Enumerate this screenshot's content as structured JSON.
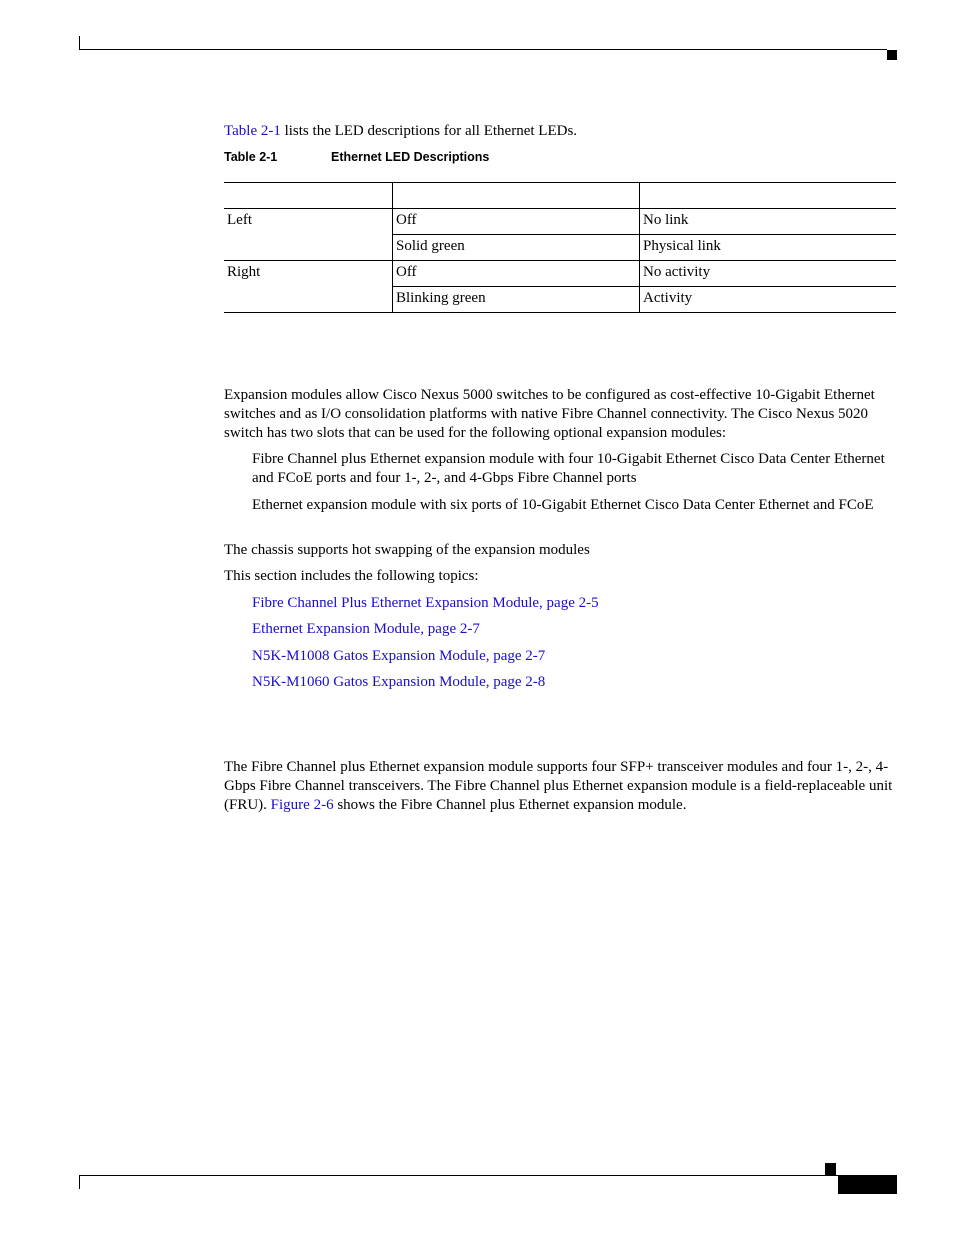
{
  "intro": {
    "link": "Table 2-1",
    "text": " lists the LED descriptions for all Ethernet LEDs."
  },
  "table_caption": {
    "number": "Table 2-1",
    "title": "Ethernet LED Descriptions"
  },
  "led_table": {
    "headers": [
      "",
      "",
      ""
    ],
    "rows": [
      {
        "led": "Left",
        "status": "Off",
        "description": "No link"
      },
      {
        "led": "",
        "status": "Solid green",
        "description": "Physical link"
      },
      {
        "led": "Right",
        "status": "Off",
        "description": "No activity"
      },
      {
        "led": "",
        "status": "Blinking green",
        "description": "Activity"
      }
    ]
  },
  "expansion": {
    "paragraph": "Expansion modules allow Cisco Nexus 5000 switches to be configured as cost-effective 10-Gigabit Ethernet switches and as I/O consolidation platforms with native Fibre Channel connectivity. The Cisco Nexus 5020 switch has two slots that can be used for the following optional expansion modules:",
    "bullets": [
      "Fibre Channel plus Ethernet expansion module with four 10-Gigabit Ethernet Cisco Data Center Ethernet and FCoE ports and four 1-, 2-, and 4-Gbps Fibre Channel ports",
      "Ethernet expansion module with six ports of 10-Gigabit Ethernet Cisco Data Center Ethernet and FCoE"
    ],
    "hot_swap": "The chassis supports hot swapping of the expansion modules",
    "topics_intro": "This section includes the following topics:",
    "topics": [
      "Fibre Channel Plus Ethernet Expansion Module, page 2-5",
      "Ethernet Expansion Module, page 2-7",
      "N5K-M1008 Gatos Expansion Module, page 2-7",
      "N5K-M1060 Gatos Expansion Module, page 2-8"
    ]
  },
  "fc_module": {
    "text_before": "The Fibre Channel plus Ethernet expansion module supports four SFP+ transceiver modules and four 1-, 2-, 4-Gbps Fibre Channel transceivers. The Fibre Channel plus Ethernet expansion module is a field-replaceable unit (FRU). ",
    "link": "Figure 2-6",
    "text_after": " shows the Fibre Channel plus Ethernet expansion module."
  },
  "colors": {
    "link": "#1a0dcc",
    "text": "#000000"
  }
}
